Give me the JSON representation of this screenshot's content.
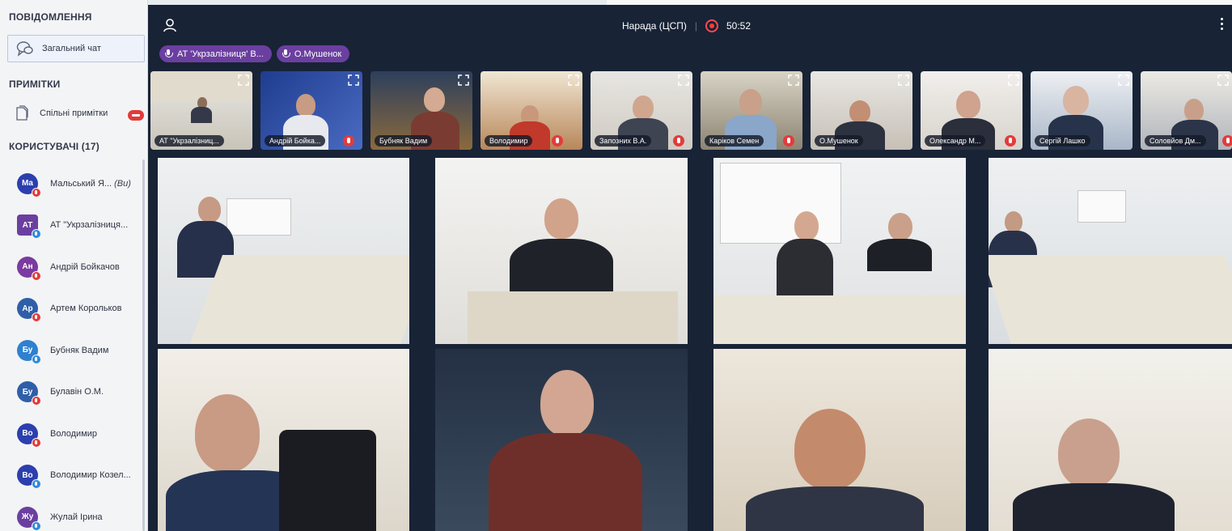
{
  "sidebar": {
    "messages_title": "ПОВІДОМЛЕННЯ",
    "general_chat": "Загальний чат",
    "notes_title": "ПРИМІТКИ",
    "shared_notes": "Спільні примітки",
    "users_title": "КОРИСТУВАЧІ (17)",
    "users": [
      {
        "initials": "Ма",
        "name": "Мальський Я...",
        "tag": "(Ви)",
        "color": "#2b3fae",
        "mic": "red"
      },
      {
        "initials": "АТ",
        "name": "АТ \"Укрзалізниця...",
        "tag": "",
        "color": "#6b3fa0",
        "mic": "blue"
      },
      {
        "initials": "Ан",
        "name": "Андрій Бойкачов",
        "tag": "",
        "color": "#7b3aa0",
        "mic": "red"
      },
      {
        "initials": "Ар",
        "name": "Артем Корольков",
        "tag": "",
        "color": "#2f5fa8",
        "mic": "red"
      },
      {
        "initials": "Бу",
        "name": "Бубняк Вадим",
        "tag": "",
        "color": "#2f80d0",
        "mic": "blue"
      },
      {
        "initials": "Бу",
        "name": "Булавін О.М.",
        "tag": "",
        "color": "#2f5fa8",
        "mic": "red"
      },
      {
        "initials": "Во",
        "name": "Володимир",
        "tag": "",
        "color": "#2b3fae",
        "mic": "red"
      },
      {
        "initials": "Во",
        "name": "Володимир Козел...",
        "tag": "",
        "color": "#2b3fae",
        "mic": "blue"
      },
      {
        "initials": "Жу",
        "name": "Жулай Ірина",
        "tag": "",
        "color": "#6b3fa0",
        "mic": "blue"
      }
    ]
  },
  "header": {
    "title": "Нарада (ЦСП)",
    "timer": "50:52"
  },
  "speakers": [
    "АТ 'Укрзалізниця' В...",
    "О.Мушенок"
  ],
  "thumbnails": [
    {
      "name": "АТ \"Укрзалізниц...",
      "muted": false
    },
    {
      "name": "Андрій Бойка...",
      "muted": true
    },
    {
      "name": "Бубняк Вадим",
      "muted": false
    },
    {
      "name": "Володимир",
      "muted": true
    },
    {
      "name": "Запозних В.А.",
      "muted": true
    },
    {
      "name": "Каріков Семен",
      "muted": true
    },
    {
      "name": "О.Мушенок",
      "muted": false
    },
    {
      "name": "Олександр М...",
      "muted": true
    },
    {
      "name": "Сергій Лашко",
      "muted": false
    },
    {
      "name": "Соловйов Дм...",
      "muted": true
    }
  ],
  "colors": {
    "main_bg": "#182336",
    "speaker_chip": "#6b3fa0",
    "record_red": "#ff3b3b",
    "muted_red": "#e33b3b"
  }
}
